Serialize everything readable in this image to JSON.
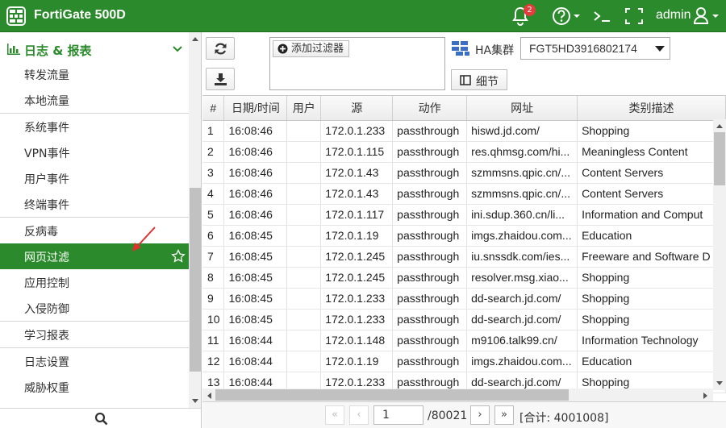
{
  "app": {
    "product": "FortiGate 500D",
    "notifications": "2",
    "user": "admin"
  },
  "sidebar": {
    "section": "日志 & 报表",
    "items": [
      "转发流量",
      "本地流量",
      "系统事件",
      "VPN事件",
      "用户事件",
      "终端事件",
      "反病毒",
      "网页过滤",
      "应用控制",
      "入侵防御",
      "学习报表",
      "日志设置",
      "威胁权重"
    ]
  },
  "toolbar": {
    "add_filter": "添加过滤器",
    "ha_label": "HA集群",
    "ha_value": "FGT5HD3916802174",
    "details": "细节"
  },
  "table": {
    "columns": [
      "#",
      "日期/时间",
      "用户",
      "源",
      "动作",
      "网址",
      "类别描述"
    ],
    "rows": [
      [
        "1",
        "16:08:46",
        "",
        "172.0.1.233",
        "passthrough",
        "hiswd.jd.com/",
        "Shopping"
      ],
      [
        "2",
        "16:08:46",
        "",
        "172.0.1.115",
        "passthrough",
        "res.qhmsg.com/hi...",
        "Meaningless Content"
      ],
      [
        "3",
        "16:08:46",
        "",
        "172.0.1.43",
        "passthrough",
        "szmmsns.qpic.cn/...",
        "Content Servers"
      ],
      [
        "4",
        "16:08:46",
        "",
        "172.0.1.43",
        "passthrough",
        "szmmsns.qpic.cn/...",
        "Content Servers"
      ],
      [
        "5",
        "16:08:46",
        "",
        "172.0.1.117",
        "passthrough",
        "ini.sdup.360.cn/li...",
        "Information and Comput"
      ],
      [
        "6",
        "16:08:45",
        "",
        "172.0.1.19",
        "passthrough",
        "imgs.zhaidou.com...",
        "Education"
      ],
      [
        "7",
        "16:08:45",
        "",
        "172.0.1.245",
        "passthrough",
        "iu.snssdk.com/ies...",
        "Freeware and Software D"
      ],
      [
        "8",
        "16:08:45",
        "",
        "172.0.1.245",
        "passthrough",
        "resolver.msg.xiao...",
        "Shopping"
      ],
      [
        "9",
        "16:08:45",
        "",
        "172.0.1.233",
        "passthrough",
        "dd-search.jd.com/",
        "Shopping"
      ],
      [
        "10",
        "16:08:45",
        "",
        "172.0.1.233",
        "passthrough",
        "dd-search.jd.com/",
        "Shopping"
      ],
      [
        "11",
        "16:08:44",
        "",
        "172.0.1.148",
        "passthrough",
        "m9106.talk99.cn/",
        "Information Technology"
      ],
      [
        "12",
        "16:08:44",
        "",
        "172.0.1.19",
        "passthrough",
        "imgs.zhaidou.com...",
        "Education"
      ],
      [
        "13",
        "16:08:44",
        "",
        "172.0.1.233",
        "passthrough",
        "dd-search.jd.com/",
        "Shopping"
      ]
    ]
  },
  "pager": {
    "page": "1",
    "total_pages": "/80021",
    "total_count": "[合计: 4001008]"
  },
  "colors": {
    "brand": "#2b8a2b",
    "arrow": "#e03030"
  }
}
